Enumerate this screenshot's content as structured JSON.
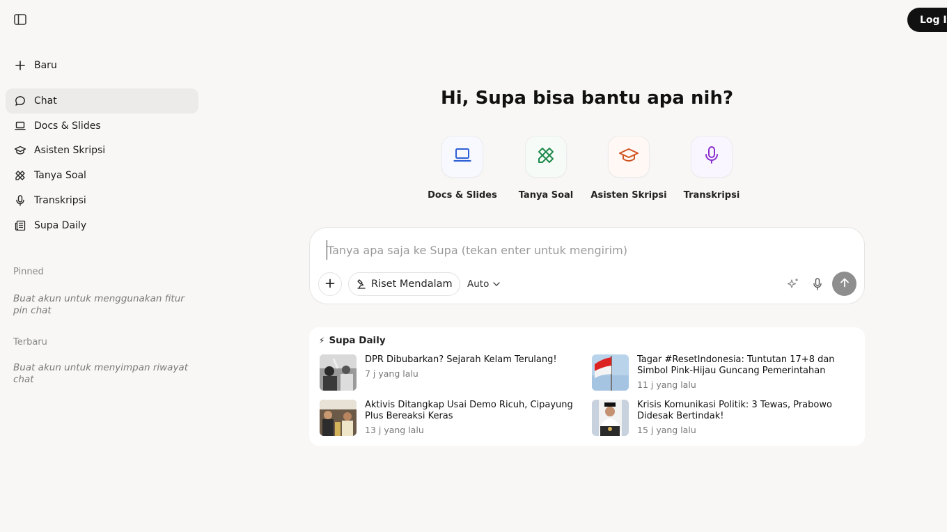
{
  "sidebar": {
    "new_label": "Baru",
    "items": [
      {
        "label": "Chat",
        "icon": "chat-bubble-icon",
        "active": true
      },
      {
        "label": "Docs & Slides",
        "icon": "laptop-icon"
      },
      {
        "label": "Asisten Skripsi",
        "icon": "graduation-cap-icon"
      },
      {
        "label": "Tanya Soal",
        "icon": "pencil-ruler-icon"
      },
      {
        "label": "Transkripsi",
        "icon": "microphone-icon"
      },
      {
        "label": "Supa Daily",
        "icon": "newspaper-icon"
      }
    ],
    "pinned_title": "Pinned",
    "pinned_note": "Buat akun untuk menggunakan fitur pin chat",
    "recent_title": "Terbaru",
    "recent_note": "Buat akun untuk menyimpan riwayat chat"
  },
  "header": {
    "login_label": "Log In"
  },
  "main": {
    "headline": "Hi, Supa bisa bantu apa nih?",
    "tools": [
      {
        "label": "Docs & Slides",
        "icon": "laptop-icon",
        "color": "#2f5fd6"
      },
      {
        "label": "Tanya Soal",
        "icon": "pencil-ruler-icon",
        "color": "#1f8a4c"
      },
      {
        "label": "Asisten Skripsi",
        "icon": "graduation-cap-icon",
        "color": "#d0531f"
      },
      {
        "label": "Transkripsi",
        "icon": "microphone-icon",
        "color": "#8a2fd0"
      }
    ],
    "composer": {
      "placeholder": "Tanya apa saja ke Supa (tekan enter untuk mengirim)",
      "value": "",
      "riset_label": "Riset Mendalam",
      "mode_label": "Auto"
    },
    "daily": {
      "title": "Supa Daily",
      "news": [
        {
          "title": "DPR Dibubarkan? Sejarah Kelam Terulang!",
          "time": "7 j yang lalu"
        },
        {
          "title": "Tagar #ResetIndonesia: Tuntutan 17+8 dan Simbol Pink-Hijau Guncang Pemerintahan",
          "time": "11 j yang lalu"
        },
        {
          "title": "Aktivis Ditangkap Usai Demo Ricuh, Cipayung Plus Bereaksi Keras",
          "time": "13 j yang lalu"
        },
        {
          "title": "Krisis Komunikasi Politik: 3 Tewas, Prabowo Didesak Bertindak!",
          "time": "15 j yang lalu"
        }
      ]
    }
  }
}
